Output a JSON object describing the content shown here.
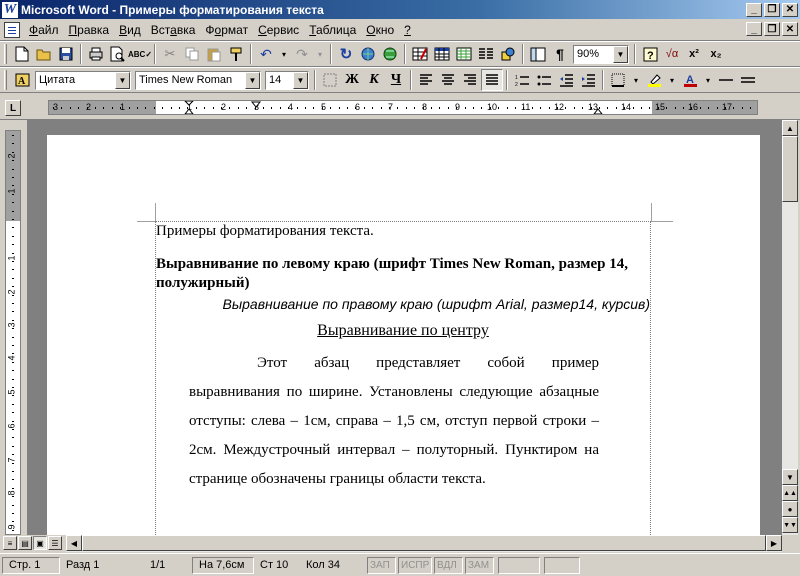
{
  "window": {
    "title": "Microsoft Word - Примеры форматирования текста",
    "icon": "word-app-icon",
    "app_icon_glyph": "W"
  },
  "menu": {
    "items": [
      {
        "label": "Файл",
        "underline": "Ф"
      },
      {
        "label": "Правка",
        "underline": "П"
      },
      {
        "label": "Вид",
        "underline": "В"
      },
      {
        "label": "Вставка",
        "underline": "а"
      },
      {
        "label": "Формат",
        "underline": "о"
      },
      {
        "label": "Сервис",
        "underline": "С"
      },
      {
        "label": "Таблица",
        "underline": "Т"
      },
      {
        "label": "Окно",
        "underline": "О"
      },
      {
        "label": "?",
        "underline": "?"
      }
    ]
  },
  "toolbar_standard": {
    "zoom": "90%"
  },
  "toolbar_format": {
    "style": "Цитата",
    "font": "Times New Roman",
    "size": "14",
    "bold_label": "Ж",
    "italic_label": "К",
    "underline_label": "Ч"
  },
  "ruler": {
    "h_numbers": [
      "3",
      "2",
      "1",
      "1",
      "2",
      "3",
      "4",
      "5",
      "6",
      "7",
      "8",
      "9",
      "10",
      "11",
      "12",
      "13",
      "14",
      "15",
      "16",
      "17"
    ],
    "v_numbers": [
      "2",
      "1",
      "1",
      "2",
      "3",
      "4",
      "5",
      "6",
      "7",
      "8",
      "9"
    ],
    "tab_marker": "L"
  },
  "document": {
    "p1": "Примеры форматирования текста.",
    "p2": "Выравнивание по левому краю (шрифт Times New Roman, размер 14, полужирный)",
    "p3": "Выравнивание по правому краю (шрифт Arial, размер14, курсив)",
    "p4": "Выравнивание по центру",
    "p5": "Этот абзац представляет собой пример выравнивания по ширине. Установлены следующие абзацные отступы: слева – 1см,  справа – 1,5 см, отступ первой строки – 2см. Междустрочный интервал – полуторный. Пунктиром на странице обозначены границы области текста."
  },
  "statusbar": {
    "page": "Стр. 1",
    "section": "Разд 1",
    "pages": "1/1",
    "at": "На 7,6см",
    "line": "Ст 10",
    "col": "Кол 34",
    "rec": "ЗАП",
    "trk": "ИСПР",
    "ext": "ВДЛ",
    "ovr": "ЗАМ"
  }
}
